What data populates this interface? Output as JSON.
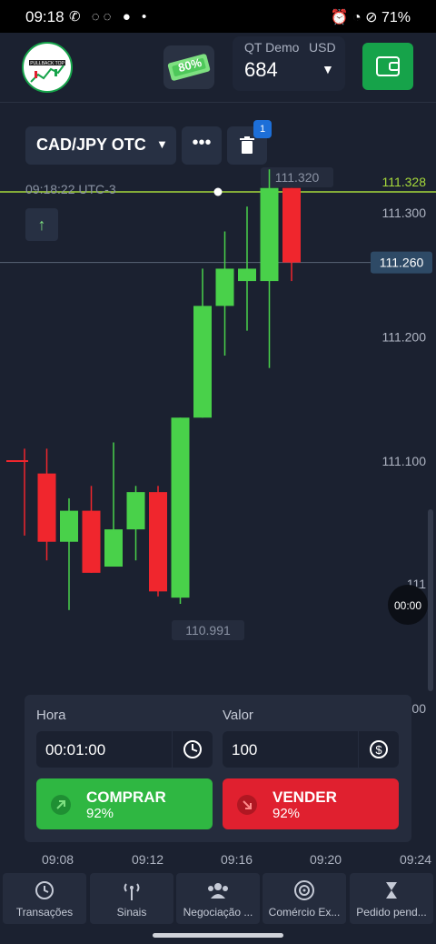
{
  "status_bar": {
    "time": "09:18",
    "icons_left": "✆ ◌◌ ● •",
    "icons_right": "⏰ ◔ ⊘ 71%"
  },
  "header": {
    "logo_text": "PULLBACK TOP",
    "promo_badge": "80%",
    "account_type": "QT Demo",
    "currency": "USD",
    "balance": "684"
  },
  "chart": {
    "asset": "CAD/JPY OTC",
    "pending_count": "1",
    "timestamp": "09:18:22 UTC-3",
    "high_marker": "111.320",
    "low_marker": "110.991",
    "current_price": "111.260",
    "line_price": "111.328",
    "timer": "00:00",
    "price_ticks": [
      "111.300",
      "111.200",
      "111.100"
    ],
    "partial_ticks": [
      "111",
      "00"
    ],
    "time_ticks": [
      "09:08",
      "09:12",
      "09:16",
      "09:20",
      "09:24"
    ],
    "candles": [
      {
        "o": 111.1,
        "c": 111.1,
        "h": 111.11,
        "l": 111.04,
        "dir": "down",
        "wick_only": true
      },
      {
        "o": 111.09,
        "c": 111.035,
        "h": 111.11,
        "l": 111.02,
        "dir": "down"
      },
      {
        "o": 111.035,
        "c": 111.06,
        "h": 111.07,
        "l": 110.98,
        "dir": "up"
      },
      {
        "o": 111.06,
        "c": 111.01,
        "h": 111.08,
        "l": 111.01,
        "dir": "down"
      },
      {
        "o": 111.015,
        "c": 111.045,
        "h": 111.115,
        "l": 111.015,
        "dir": "up"
      },
      {
        "o": 111.045,
        "c": 111.075,
        "h": 111.08,
        "l": 111.02,
        "dir": "up"
      },
      {
        "o": 111.075,
        "c": 110.995,
        "h": 111.08,
        "l": 110.991,
        "dir": "down"
      },
      {
        "o": 110.99,
        "c": 111.135,
        "h": 111.135,
        "l": 110.985,
        "dir": "up"
      },
      {
        "o": 111.135,
        "c": 111.225,
        "h": 111.255,
        "l": 111.135,
        "dir": "up"
      },
      {
        "o": 111.225,
        "c": 111.255,
        "h": 111.285,
        "l": 111.185,
        "dir": "up"
      },
      {
        "o": 111.245,
        "c": 111.255,
        "h": 111.305,
        "l": 111.205,
        "dir": "up"
      },
      {
        "o": 111.245,
        "c": 111.32,
        "h": 111.335,
        "l": 111.175,
        "dir": "up"
      },
      {
        "o": 111.32,
        "c": 111.26,
        "h": 111.32,
        "l": 111.245,
        "dir": "down"
      }
    ]
  },
  "trade_panel": {
    "time_label": "Hora",
    "time_value": "00:01:00",
    "amount_label": "Valor",
    "amount_value": "100",
    "buy_label": "COMPRAR",
    "buy_pct": "92%",
    "sell_label": "VENDER",
    "sell_pct": "92%"
  },
  "bottom_nav": [
    {
      "label": "Transações",
      "icon": "history-icon"
    },
    {
      "label": "Sinais",
      "icon": "signal-icon"
    },
    {
      "label": "Negociação ...",
      "icon": "users-icon"
    },
    {
      "label": "Comércio Ex...",
      "icon": "target-icon"
    },
    {
      "label": "Pedido pend...",
      "icon": "hourglass-icon"
    }
  ],
  "colors": {
    "up": "#49d14a",
    "down": "#f0262d",
    "accent_green": "#16a34a",
    "price_line": "#a6d93b"
  }
}
